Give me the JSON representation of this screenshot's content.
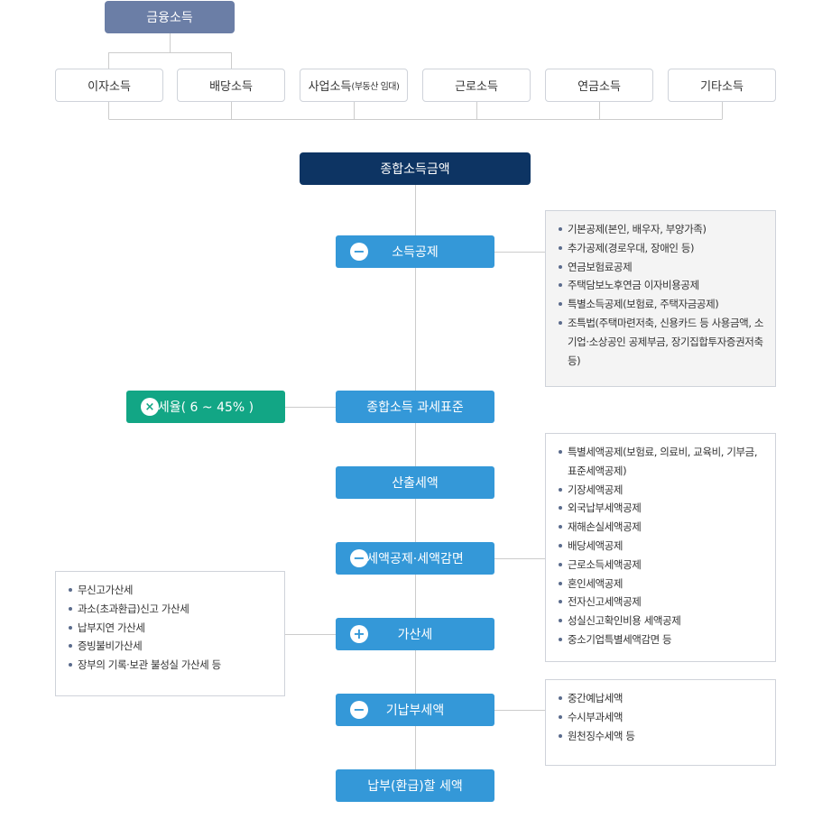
{
  "root_label": "금융소득",
  "income_sources": [
    {
      "label": "이자소득",
      "note": ""
    },
    {
      "label": "배당소득",
      "note": ""
    },
    {
      "label": "사업소득",
      "note": "(부동산 임대)"
    },
    {
      "label": "근로소득",
      "note": ""
    },
    {
      "label": "연금소득",
      "note": ""
    },
    {
      "label": "기타소득",
      "note": ""
    }
  ],
  "total_income_label": "종합소득금액",
  "steps": [
    {
      "key": "income_deduction",
      "label": "소득공제",
      "icon": "minus-icon",
      "icon_glyph": "−"
    },
    {
      "key": "tax_base",
      "label": "종합소득 과세표준",
      "icon": "",
      "icon_glyph": ""
    },
    {
      "key": "calculated_tax",
      "label": "산출세액",
      "icon": "",
      "icon_glyph": ""
    },
    {
      "key": "tax_credit",
      "label": "세액공제·세액감면",
      "icon": "minus-icon",
      "icon_glyph": "−"
    },
    {
      "key": "additional_tax",
      "label": "가산세",
      "icon": "plus-icon",
      "icon_glyph": "+"
    },
    {
      "key": "prepaid_tax",
      "label": "기납부세액",
      "icon": "minus-icon",
      "icon_glyph": "−"
    },
    {
      "key": "payable_tax",
      "label": "납부(환급)할 세액",
      "icon": "",
      "icon_glyph": ""
    }
  ],
  "tax_rate": {
    "label": "세율( 6 ~ 45% )",
    "icon": "multiply-icon",
    "icon_glyph": "×",
    "color": "#12a685"
  },
  "details": {
    "income_deduction": [
      "기본공제(본인, 배우자, 부양가족)",
      "추가공제(경로우대, 장애인 등)",
      "연금보험료공제",
      "주택담보노후연금 이자비용공제",
      "특별소득공제(보험료, 주택자금공제)",
      "조특법(주택마련저축, 신용카드 등 사용금액, 소기업·소상공인 공제부금, 장기집합투자증권저축 등)"
    ],
    "tax_credit": [
      "특별세액공제(보험료, 의료비, 교육비, 기부금, 표준세액공제)",
      "기장세액공제",
      "외국납부세액공제",
      "재해손실세액공제",
      "배당세액공제",
      "근로소득세액공제",
      "혼인세액공제",
      "전자신고세액공제",
      "성실신고확인비용 세액공제",
      "중소기업특별세액감면 등"
    ],
    "additional_tax": [
      "무신고가산세",
      "과소(초과환급)신고 가산세",
      "납부지연 가산세",
      "증빙불비가산세",
      "장부의 기록·보관 불성실 가산세 등"
    ],
    "prepaid_tax": [
      "중간예납세액",
      "수시부과세액",
      "원천징수세액 등"
    ]
  },
  "colors": {
    "root": "#6b7ea6",
    "total": "#0d3463",
    "step": "#3498d8",
    "rate": "#12a685",
    "line": "#cccccc"
  }
}
